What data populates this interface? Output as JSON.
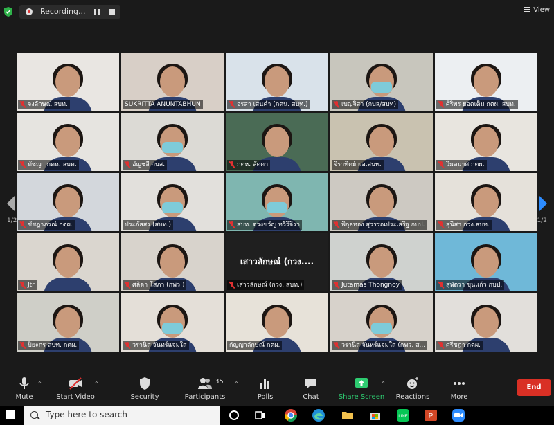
{
  "recording": {
    "label": "Recording..."
  },
  "view": {
    "label": "View"
  },
  "pagination": {
    "left": "1/2",
    "right": "1/2"
  },
  "tiles": [
    {
      "name": "จงลักษณ์ สบท.",
      "muted": true,
      "bg": "#e9e6e2",
      "mask": false
    },
    {
      "name": "SUKRITTA ANUNTABHUN",
      "muted": false,
      "bg": "#d8cfc7",
      "mask": false,
      "active": true
    },
    {
      "name": "อรสา เสนคำ (กตน. สบท.)",
      "muted": true,
      "bg": "#d9e2ea",
      "mask": false
    },
    {
      "name": "เบญจิสา (กบส/สบท)",
      "muted": true,
      "bg": "#c8c6bd",
      "mask": true
    },
    {
      "name": "ศิริพร ยอดเต็ม กตผ. สบท.",
      "muted": true,
      "bg": "#eceff2",
      "mask": false
    },
    {
      "name": "ทัชญา กตห. สบท.",
      "muted": true,
      "bg": "#e6e4e0",
      "mask": false
    },
    {
      "name": "อัญชลี กบส.",
      "muted": true,
      "bg": "#dcdad5",
      "mask": true
    },
    {
      "name": "กตห. ลัดดา",
      "muted": true,
      "bg": "#4a6b55",
      "mask": false
    },
    {
      "name": "จิราทิตย์  ผอ.สบท.",
      "muted": false,
      "bg": "#c9c2b0",
      "mask": false
    },
    {
      "name": "วิมลมาศ กตผ.",
      "muted": true,
      "bg": "#e8e5df",
      "mask": false
    },
    {
      "name": "ชัชฎาภรณ์ กตผ.",
      "muted": true,
      "bg": "#d3d7dc",
      "mask": false
    },
    {
      "name": "ประภัสสร (สบท.)",
      "muted": false,
      "bg": "#e2e0dc",
      "mask": true
    },
    {
      "name": "สบท. ดวงขวัญ ทวีวิจิรา",
      "muted": true,
      "bg": "#7fb6b0",
      "mask": true
    },
    {
      "name": "พิกุลทอง สุวรรณประเสริฐ กบป.",
      "muted": true,
      "bg": "#cdc9c2",
      "mask": false
    },
    {
      "name": "สุนิสา กวง.สบท.",
      "muted": true,
      "bg": "#e5e1da",
      "mask": false
    },
    {
      "name": "Jtr",
      "muted": true,
      "bg": "#dad6cf",
      "mask": false
    },
    {
      "name": "ศลิตา โสภา (กพว.)",
      "muted": true,
      "bg": "#d8d3cc",
      "mask": false
    },
    {
      "name": "เสาวลักษณ์ (กวง. สบท.)",
      "muted": true,
      "nameonly": "เสาวลักษณ์ (กวง....",
      "bg": "#1f1f1f"
    },
    {
      "name": "Jutamas Thongnoy",
      "muted": true,
      "bg": "#cfd2cf",
      "mask": false
    },
    {
      "name": "สุพัตรา ขุนแก้ว กบป.",
      "muted": true,
      "bg": "#6fb8d8",
      "mask": false
    },
    {
      "name": "ปิยะกร สบท. กตผ.",
      "muted": true,
      "bg": "#cfcfc8",
      "mask": false
    },
    {
      "name": "วรานิส จันทร์แจ่มใส",
      "muted": true,
      "bg": "#e4dfd8",
      "mask": true
    },
    {
      "name": "กัญญาลักษณ์ กตผ.",
      "muted": false,
      "bg": "#e7e2d9",
      "mask": false
    },
    {
      "name": "วรานิส จันทร์แจ่มใส (กพว. ส...",
      "muted": true,
      "bg": "#d7d2cb",
      "mask": true
    },
    {
      "name": "ศรีชฎา กตผ.",
      "muted": true,
      "bg": "#e2dfdb",
      "mask": false
    }
  ],
  "toolbar": {
    "mute": "Mute",
    "start_video": "Start Video",
    "security": "Security",
    "participants": "Participants",
    "participants_count": "35",
    "polls": "Polls",
    "chat": "Chat",
    "share_screen": "Share Screen",
    "reactions": "Reactions",
    "more": "More",
    "end": "End"
  },
  "taskbar": {
    "search_placeholder": "Type here to search"
  },
  "colors": {
    "share_green": "#2ecc71",
    "end_red": "#d93025",
    "active_outline": "#d8e37a",
    "arrow_blue": "#2d8cff"
  }
}
